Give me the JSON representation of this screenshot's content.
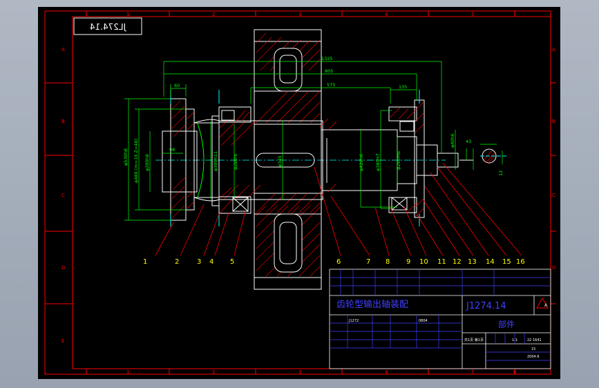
{
  "drawing": {
    "code": "J1274.14",
    "code_mirrored": "JL274.14",
    "title": "齿轮型输出轴装配",
    "subtitle": "部件",
    "colors": {
      "background": "#000000",
      "frame": "#ff0000",
      "outline": "#ffffff",
      "dimension": "#00ff00",
      "leader": "#ff0000",
      "hatch": "#ff0000",
      "centerline": "#00ffff",
      "titleblock": "#4040ff",
      "label": "#ffff00"
    },
    "dimensions": {
      "d1325": "1325",
      "d805": "805",
      "d575": "575",
      "d135": "135",
      "d60": "60",
      "d98": "98",
      "d43": "43",
      "d12": "12",
      "phi530": "φ530h8",
      "phi480": "φ480 (m=10 Z=48)",
      "phi200": "φ200h8",
      "phi300": "φ300h11",
      "phi280": "φ280r6",
      "phi345": "φ345",
      "phi42": "φ420h6",
      "phi380": "φ380H7",
      "phi240": "φ240m6",
      "phi40": "φ40h6"
    },
    "part_numbers": [
      "1",
      "2",
      "3",
      "4",
      "5",
      "6",
      "7",
      "8",
      "9",
      "10",
      "11",
      "12",
      "13",
      "14",
      "15",
      "16"
    ],
    "zones_top": [
      "1",
      "2",
      "3",
      "4",
      "5",
      "6"
    ],
    "zones_side": [
      "A",
      "B",
      "C",
      "D",
      "E"
    ],
    "titleblock": {
      "field1": "J1272",
      "field2": "0804",
      "scale": "1:1",
      "sheet": "15",
      "date": "2004.6",
      "sheet_info": "共1页 第1页",
      "weight": "22 1641",
      "mark": "A"
    }
  }
}
